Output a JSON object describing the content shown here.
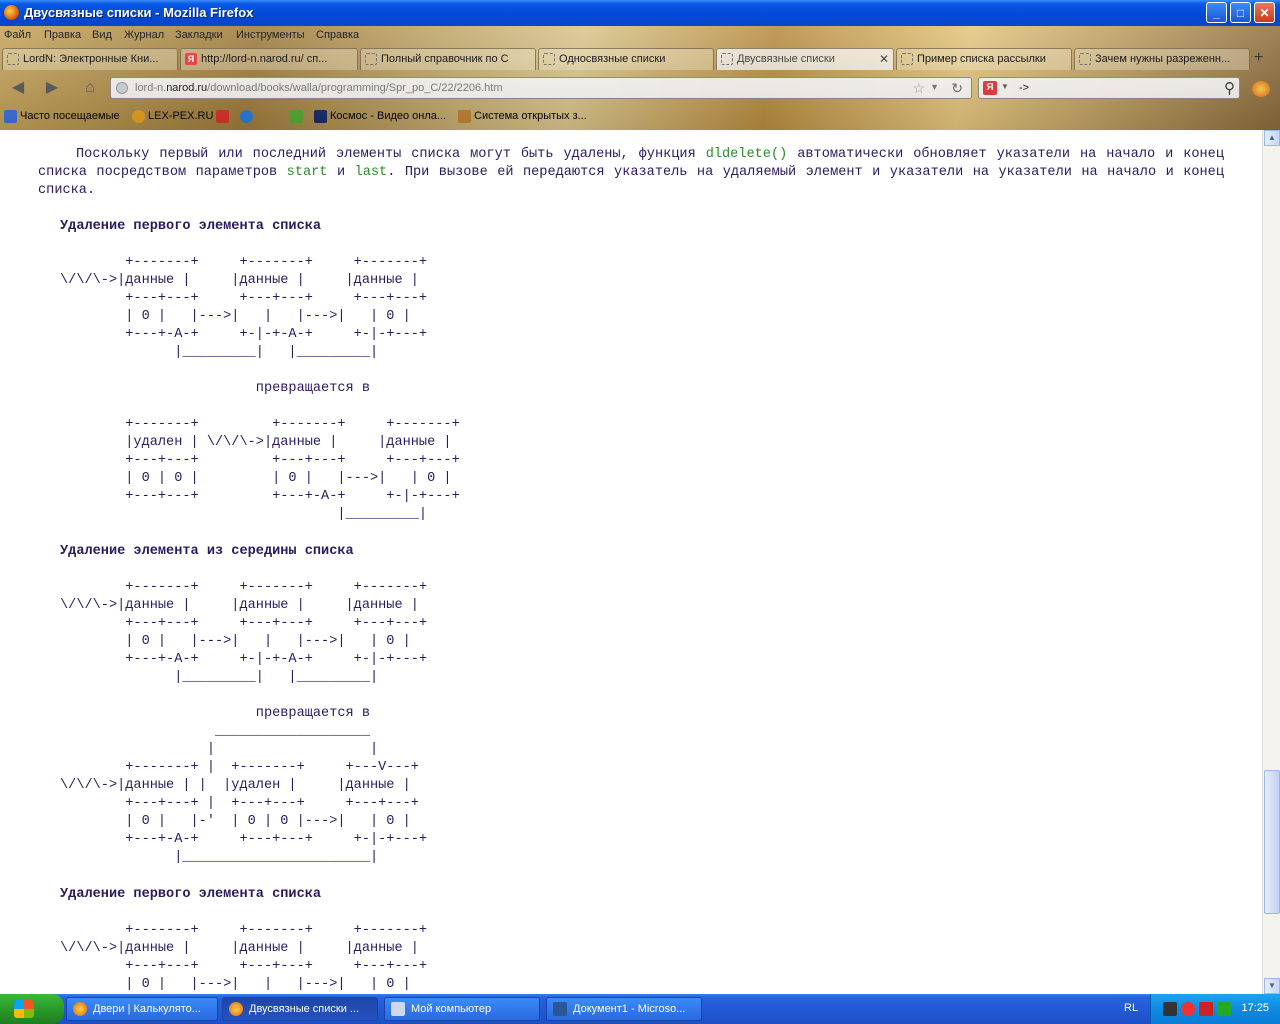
{
  "window": {
    "title": "Двусвязные списки - Mozilla Firefox",
    "buttons": {
      "minimize": "_",
      "maximize": "□",
      "close": "✕"
    }
  },
  "menu": [
    "Файл",
    "Правка",
    "Вид",
    "Журнал",
    "Закладки",
    "Инструменты",
    "Справка"
  ],
  "tabs": [
    {
      "label": "LordN: Электронные Кни...",
      "icon": "page-icon"
    },
    {
      "label": "http://lord-n.narod.ru/ сп...",
      "icon": "yandex-icon"
    },
    {
      "label": "Полный справочник по C",
      "icon": "page-icon"
    },
    {
      "label": "Односвязные списки",
      "icon": "page-icon"
    },
    {
      "label": "Двусвязные списки",
      "icon": "page-icon",
      "active": true
    },
    {
      "label": "Пример списка рассылки",
      "icon": "page-icon"
    },
    {
      "label": "Зачем нужны разреженн...",
      "icon": "page-icon"
    }
  ],
  "navbar": {
    "url_prefix": "lord-n.",
    "url_host": "narod.ru",
    "url_path": "/download/books/walla/programming/Spr_po_C/22/2206.htm",
    "search_value": "->"
  },
  "bookmarks": [
    {
      "label": "Часто посещаемые",
      "icon": "search-page-icon",
      "color": "#3b6fd8"
    },
    {
      "label": "LEX-PEX.RU",
      "icon": "person-icon",
      "color": "#e8a020"
    },
    {
      "label": "",
      "icon": "gmail-icon",
      "color": "#d93025"
    },
    {
      "label": "",
      "icon": "mail-at-icon",
      "color": "#2a7ad8"
    },
    {
      "label": "",
      "icon": "puzzle-icon",
      "color": "#55aa33"
    },
    {
      "label": "Космос - Видео онла...",
      "icon": "space-icon",
      "color": "#1a2a6a"
    },
    {
      "label": "Система открытых з...",
      "icon": "columns-icon",
      "color": "#c08030"
    }
  ],
  "content": {
    "paragraph": {
      "t1": "Поскольку первый или последний элементы списка могут быть удалены, функция ",
      "code1": "dldelete()",
      "t2": " автоматически обновляет указатели на начало и конец списка посредством параметров ",
      "code2": "start",
      "t3": " и ",
      "code3": "last",
      "t4": ". При вызове ей передаются указатель на удаляемый элемент и указатели на указатели на начало и конец списка."
    },
    "heading1": "Удаление первого элемента списка",
    "diagram1": "        +-------+     +-------+     +-------+\n\\/\\/\\->|данные |     |данные |     |данные |\n        +---+---+     +---+---+     +---+---+\n        | 0 |   |--->|   |   |--->|   | 0 |\n        +---+-A-+     +-|-+-A-+     +-|-+---+\n              |_________|   |_________|\n\n                        превращается в\n\n        +-------+         +-------+     +-------+\n        |удален | \\/\\/\\->|данные |     |данные |\n        +---+---+         +---+---+     +---+---+\n        | 0 | 0 |         | 0 |   |--->|   | 0 |\n        +---+---+         +---+-A-+     +-|-+---+\n                                  |_________|",
    "heading2": "Удаление элемента из середины списка",
    "diagram2": "        +-------+     +-------+     +-------+\n\\/\\/\\->|данные |     |данные |     |данные |\n        +---+---+     +---+---+     +---+---+\n        | 0 |   |--->|   |   |--->|   | 0 |\n        +---+-A-+     +-|-+-A-+     +-|-+---+\n              |_________|   |_________|\n\n                        превращается в\n                   ___________________\n                  |                   |\n        +-------+ |  +-------+     +---V---+\n\\/\\/\\->|данные | |  |удален |     |данные |\n        +---+---+ |  +---+---+     +---+---+\n        | 0 |   |-'  | 0 | 0 |--->|   | 0 |\n        +---+-A-+     +---+---+     +-|-+---+\n              |_______________________|",
    "heading3": "Удаление первого элемента списка",
    "diagram3": "        +-------+     +-------+     +-------+\n\\/\\/\\->|данные |     |данные |     |данные |\n        +---+---+     +---+---+     +---+---+\n        | 0 |   |--->|   |   |--->|   | 0 |"
  },
  "taskbar": {
    "start_label": "",
    "tasks": [
      {
        "label": "Двери | Калькулято...",
        "icon": "firefox-icon"
      },
      {
        "label": "Двусвязные списки ...",
        "icon": "firefox-icon",
        "active": true
      },
      {
        "label": "Мой компьютер",
        "icon": "computer-icon"
      },
      {
        "label": "Документ1 - Microso...",
        "icon": "word-icon"
      }
    ],
    "language": "RL",
    "time": "17:25"
  }
}
